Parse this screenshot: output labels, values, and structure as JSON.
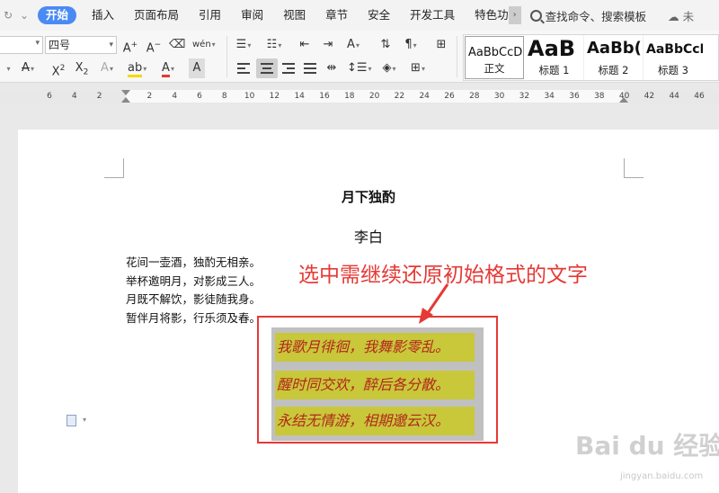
{
  "menubar": {
    "tabs": [
      "开始",
      "插入",
      "页面布局",
      "引用",
      "审阅",
      "视图",
      "章节",
      "安全",
      "开发工具",
      "特色功"
    ],
    "active_tab": "开始",
    "search_placeholder": "查找命令、搜索模板",
    "cloud_label": "未"
  },
  "ribbon": {
    "font_size": "四号",
    "styles": [
      {
        "preview": "AaBbCcD",
        "label": "正文"
      },
      {
        "preview": "AaB",
        "label": "标题 1"
      },
      {
        "preview": "AaBb(",
        "label": "标题 2"
      },
      {
        "preview": "AaBbCcI",
        "label": "标题 3"
      }
    ]
  },
  "ruler": {
    "ticks": [
      "6",
      "4",
      "2",
      "2",
      "4",
      "6",
      "8",
      "10",
      "12",
      "14",
      "16",
      "18",
      "20",
      "22",
      "24",
      "26",
      "28",
      "30",
      "32",
      "34",
      "36",
      "38",
      "40",
      "42",
      "44",
      "46"
    ]
  },
  "document": {
    "title": "月下独酌",
    "author": "李白",
    "lines": [
      "花间一壶酒，独酌无相亲。",
      "举杯邀明月，对影成三人。",
      "月既不解饮，影徒随我身。",
      "暂伴月将影，行乐须及春。"
    ],
    "highlighted_lines": [
      "我歌月徘徊，我舞影零乱。",
      "醒时同交欢，醉后各分散。",
      "永结无情游，相期邈云汉。"
    ],
    "annotation": "选中需继续还原初始格式的文字"
  },
  "watermark": {
    "text": "Bai du 经验",
    "sub": "jingyan.baidu.com"
  },
  "colors": {
    "accent": "#4a8af4",
    "annotation": "#e53935",
    "highlight": "#c8c83a",
    "highlight_text": "#b3261e"
  }
}
